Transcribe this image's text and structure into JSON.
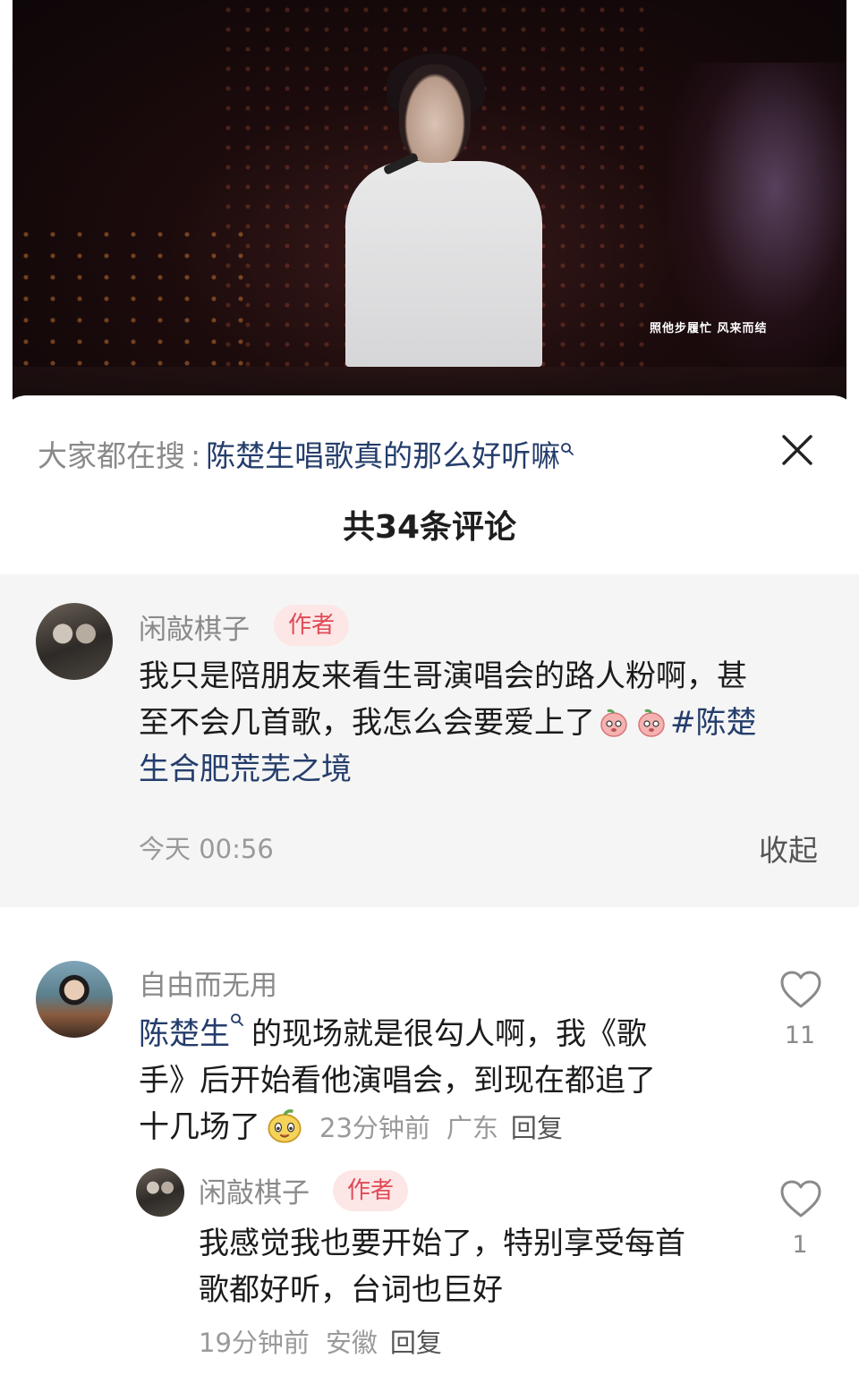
{
  "video": {
    "lyric": "照他步履忙 风来而结"
  },
  "search_bar": {
    "prefix": "大家都在搜",
    "colon": ":",
    "query": "陈楚生唱歌真的那么好听嘛"
  },
  "comments_header": {
    "count_title": "共34条评论"
  },
  "pinned_comment": {
    "username": "闲敲棋子",
    "badge": "作者",
    "text_line1": "我只是陪朋友来看生哥演唱会的路人粉啊，甚",
    "text_line2": "至不会几首歌，我怎么会要爱上了",
    "hashtag_part1": "#陈楚",
    "text_line3": "生合肥荒芜之境",
    "time": "今天 00:56",
    "collapse_label": "收起"
  },
  "comments": [
    {
      "username": "自由而无用",
      "mention": "陈楚生",
      "text_line1_rest": "的现场就是很勾人啊，我《歌",
      "text_line2": "手》后开始看他演唱会，到现在都追了",
      "text_line3": "十几场了",
      "time": "23分钟前",
      "location": "广东",
      "reply_label": "回复",
      "likes": "11",
      "replies": [
        {
          "username": "闲敲棋子",
          "badge": "作者",
          "text_line1": "我感觉我也要开始了，特别享受每首",
          "text_line2": "歌都好听，台词也巨好",
          "time": "19分钟前",
          "location": "安徽",
          "reply_label": "回复",
          "likes": "1"
        }
      ]
    }
  ],
  "colors": {
    "link": "#243d6b",
    "badge_text": "#e04a55",
    "badge_bg": "#fde6e6",
    "muted": "#8a8a8a"
  },
  "icons": [
    "search-icon",
    "close-icon",
    "heart-icon",
    "emoji-peach-icon",
    "emoji-mango-icon"
  ]
}
